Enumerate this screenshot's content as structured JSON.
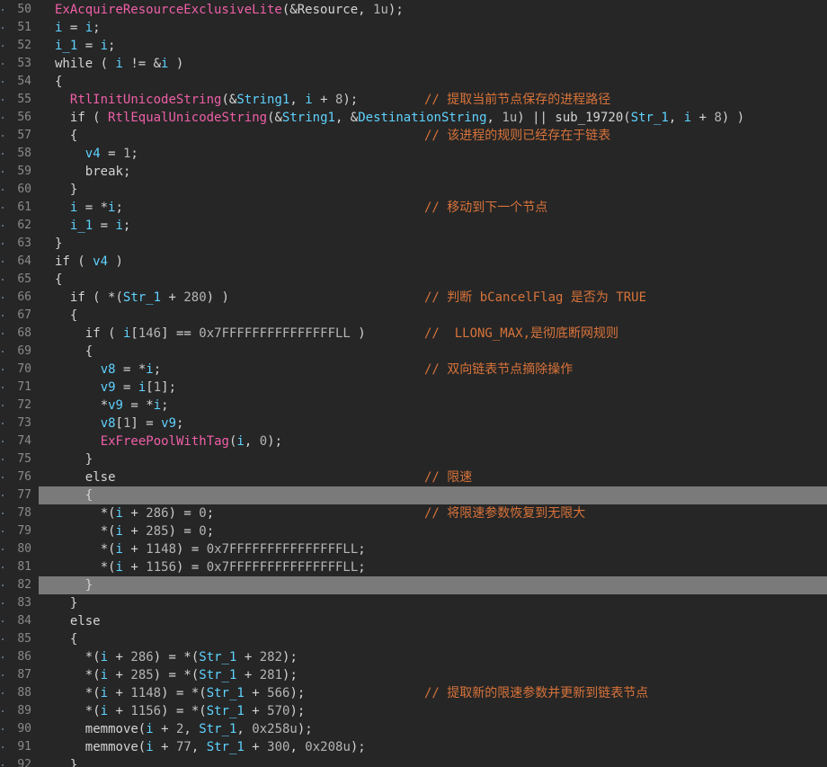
{
  "colors": {
    "background": "#262626",
    "gutter_text": "#8a8a8a",
    "current_line_highlight": "#7a7a7a",
    "plain": "#d4d4d4",
    "function": "#ef5fa7",
    "variable": "#5fd2ff",
    "number": "#b5b5b5",
    "comment": "#d8733a"
  },
  "highlighted_lines": [
    77,
    82
  ],
  "lines": [
    {
      "n": 50,
      "indent": 0,
      "tokens": [
        [
          "fn",
          "ExAcquireResourceExclusiveLite"
        ],
        [
          "txt",
          "(&Resource, "
        ],
        [
          "num",
          "1u"
        ],
        [
          "txt",
          ");"
        ]
      ]
    },
    {
      "n": 51,
      "indent": 0,
      "tokens": [
        [
          "var",
          "i"
        ],
        [
          "txt",
          " = "
        ],
        [
          "var",
          "i"
        ],
        [
          "txt",
          ";"
        ]
      ]
    },
    {
      "n": 52,
      "indent": 0,
      "tokens": [
        [
          "var",
          "i_1"
        ],
        [
          "txt",
          " = "
        ],
        [
          "var",
          "i"
        ],
        [
          "txt",
          ";"
        ]
      ]
    },
    {
      "n": 53,
      "indent": 0,
      "tokens": [
        [
          "kw",
          "while"
        ],
        [
          "txt",
          " ( "
        ],
        [
          "var",
          "i"
        ],
        [
          "txt",
          " != &"
        ],
        [
          "var",
          "i"
        ],
        [
          "txt",
          " )"
        ]
      ]
    },
    {
      "n": 54,
      "indent": 0,
      "tokens": [
        [
          "txt",
          "{"
        ]
      ]
    },
    {
      "n": 55,
      "indent": 1,
      "tokens": [
        [
          "fn",
          "RtlInitUnicodeString"
        ],
        [
          "txt",
          "(&"
        ],
        [
          "var",
          "String1"
        ],
        [
          "txt",
          ", "
        ],
        [
          "var",
          "i"
        ],
        [
          "txt",
          " + "
        ],
        [
          "num",
          "8"
        ],
        [
          "txt",
          ");"
        ]
      ],
      "comment": "// 提取当前节点保存的进程路径"
    },
    {
      "n": 56,
      "indent": 1,
      "tokens": [
        [
          "kw",
          "if"
        ],
        [
          "txt",
          " ( "
        ],
        [
          "fn",
          "RtlEqualUnicodeString"
        ],
        [
          "txt",
          "(&"
        ],
        [
          "var",
          "String1"
        ],
        [
          "txt",
          ", &"
        ],
        [
          "var",
          "DestinationString"
        ],
        [
          "txt",
          ", "
        ],
        [
          "num",
          "1u"
        ],
        [
          "txt",
          ") || "
        ],
        [
          "txt",
          "sub_19720"
        ],
        [
          "txt",
          "("
        ],
        [
          "var",
          "Str_1"
        ],
        [
          "txt",
          ", "
        ],
        [
          "var",
          "i"
        ],
        [
          "txt",
          " + "
        ],
        [
          "num",
          "8"
        ],
        [
          "txt",
          ") )"
        ]
      ]
    },
    {
      "n": 57,
      "indent": 1,
      "tokens": [
        [
          "txt",
          "{"
        ]
      ],
      "comment": "// 该进程的规则已经存在于链表"
    },
    {
      "n": 58,
      "indent": 2,
      "tokens": [
        [
          "var",
          "v4"
        ],
        [
          "txt",
          " = "
        ],
        [
          "num",
          "1"
        ],
        [
          "txt",
          ";"
        ]
      ]
    },
    {
      "n": 59,
      "indent": 2,
      "tokens": [
        [
          "kw",
          "break"
        ],
        [
          "txt",
          ";"
        ]
      ]
    },
    {
      "n": 60,
      "indent": 1,
      "tokens": [
        [
          "txt",
          "}"
        ]
      ]
    },
    {
      "n": 61,
      "indent": 1,
      "tokens": [
        [
          "var",
          "i"
        ],
        [
          "txt",
          " = *"
        ],
        [
          "var",
          "i"
        ],
        [
          "txt",
          ";"
        ]
      ],
      "comment": "// 移动到下一个节点"
    },
    {
      "n": 62,
      "indent": 1,
      "tokens": [
        [
          "var",
          "i_1"
        ],
        [
          "txt",
          " = "
        ],
        [
          "var",
          "i"
        ],
        [
          "txt",
          ";"
        ]
      ]
    },
    {
      "n": 63,
      "indent": 0,
      "tokens": [
        [
          "txt",
          "}"
        ]
      ]
    },
    {
      "n": 64,
      "indent": 0,
      "tokens": [
        [
          "kw",
          "if"
        ],
        [
          "txt",
          " ( "
        ],
        [
          "var",
          "v4"
        ],
        [
          "txt",
          " )"
        ]
      ]
    },
    {
      "n": 65,
      "indent": 0,
      "tokens": [
        [
          "txt",
          "{"
        ]
      ]
    },
    {
      "n": 66,
      "indent": 1,
      "tokens": [
        [
          "kw",
          "if"
        ],
        [
          "txt",
          " ( *("
        ],
        [
          "var",
          "Str_1"
        ],
        [
          "txt",
          " + "
        ],
        [
          "num",
          "280"
        ],
        [
          "txt",
          ") )"
        ]
      ],
      "comment": "// 判断 bCancelFlag 是否为 TRUE"
    },
    {
      "n": 67,
      "indent": 1,
      "tokens": [
        [
          "txt",
          "{"
        ]
      ]
    },
    {
      "n": 68,
      "indent": 2,
      "tokens": [
        [
          "kw",
          "if"
        ],
        [
          "txt",
          " ( "
        ],
        [
          "var",
          "i"
        ],
        [
          "txt",
          "["
        ],
        [
          "num",
          "146"
        ],
        [
          "txt",
          "] == "
        ],
        [
          "num",
          "0x7FFFFFFFFFFFFFFFLL"
        ],
        [
          "txt",
          " )"
        ]
      ],
      "comment": "//  LLONG_MAX,是彻底断网规则"
    },
    {
      "n": 69,
      "indent": 2,
      "tokens": [
        [
          "txt",
          "{"
        ]
      ]
    },
    {
      "n": 70,
      "indent": 3,
      "tokens": [
        [
          "var",
          "v8"
        ],
        [
          "txt",
          " = *"
        ],
        [
          "var",
          "i"
        ],
        [
          "txt",
          ";"
        ]
      ],
      "comment": "// 双向链表节点摘除操作"
    },
    {
      "n": 71,
      "indent": 3,
      "tokens": [
        [
          "var",
          "v9"
        ],
        [
          "txt",
          " = "
        ],
        [
          "var",
          "i"
        ],
        [
          "txt",
          "["
        ],
        [
          "num",
          "1"
        ],
        [
          "txt",
          "];"
        ]
      ]
    },
    {
      "n": 72,
      "indent": 3,
      "tokens": [
        [
          "txt",
          "*"
        ],
        [
          "var",
          "v9"
        ],
        [
          "txt",
          " = *"
        ],
        [
          "var",
          "i"
        ],
        [
          "txt",
          ";"
        ]
      ]
    },
    {
      "n": 73,
      "indent": 3,
      "tokens": [
        [
          "var",
          "v8"
        ],
        [
          "txt",
          "["
        ],
        [
          "num",
          "1"
        ],
        [
          "txt",
          "] = "
        ],
        [
          "var",
          "v9"
        ],
        [
          "txt",
          ";"
        ]
      ]
    },
    {
      "n": 74,
      "indent": 3,
      "tokens": [
        [
          "fn",
          "ExFreePoolWithTag"
        ],
        [
          "txt",
          "("
        ],
        [
          "var",
          "i"
        ],
        [
          "txt",
          ", "
        ],
        [
          "num",
          "0"
        ],
        [
          "txt",
          ");"
        ]
      ]
    },
    {
      "n": 75,
      "indent": 2,
      "tokens": [
        [
          "txt",
          "}"
        ]
      ]
    },
    {
      "n": 76,
      "indent": 2,
      "tokens": [
        [
          "kw",
          "else"
        ]
      ],
      "comment": "// 限速"
    },
    {
      "n": 77,
      "indent": 2,
      "tokens": [
        [
          "txt",
          "{"
        ]
      ]
    },
    {
      "n": 78,
      "indent": 3,
      "tokens": [
        [
          "txt",
          "*("
        ],
        [
          "var",
          "i"
        ],
        [
          "txt",
          " + "
        ],
        [
          "num",
          "286"
        ],
        [
          "txt",
          ") = "
        ],
        [
          "num",
          "0"
        ],
        [
          "txt",
          ";"
        ]
      ],
      "comment": "// 将限速参数恢复到无限大"
    },
    {
      "n": 79,
      "indent": 3,
      "tokens": [
        [
          "txt",
          "*("
        ],
        [
          "var",
          "i"
        ],
        [
          "txt",
          " + "
        ],
        [
          "num",
          "285"
        ],
        [
          "txt",
          ") = "
        ],
        [
          "num",
          "0"
        ],
        [
          "txt",
          ";"
        ]
      ]
    },
    {
      "n": 80,
      "indent": 3,
      "tokens": [
        [
          "txt",
          "*("
        ],
        [
          "var",
          "i"
        ],
        [
          "txt",
          " + "
        ],
        [
          "num",
          "1148"
        ],
        [
          "txt",
          ") = "
        ],
        [
          "num",
          "0x7FFFFFFFFFFFFFFFLL"
        ],
        [
          "txt",
          ";"
        ]
      ]
    },
    {
      "n": 81,
      "indent": 3,
      "tokens": [
        [
          "txt",
          "*("
        ],
        [
          "var",
          "i"
        ],
        [
          "txt",
          " + "
        ],
        [
          "num",
          "1156"
        ],
        [
          "txt",
          ") = "
        ],
        [
          "num",
          "0x7FFFFFFFFFFFFFFFLL"
        ],
        [
          "txt",
          ";"
        ]
      ]
    },
    {
      "n": 82,
      "indent": 2,
      "tokens": [
        [
          "txt",
          "}"
        ]
      ]
    },
    {
      "n": 83,
      "indent": 1,
      "tokens": [
        [
          "txt",
          "}"
        ]
      ]
    },
    {
      "n": 84,
      "indent": 1,
      "tokens": [
        [
          "kw",
          "else"
        ]
      ]
    },
    {
      "n": 85,
      "indent": 1,
      "tokens": [
        [
          "txt",
          "{"
        ]
      ]
    },
    {
      "n": 86,
      "indent": 2,
      "tokens": [
        [
          "txt",
          "*("
        ],
        [
          "var",
          "i"
        ],
        [
          "txt",
          " + "
        ],
        [
          "num",
          "286"
        ],
        [
          "txt",
          ") = *("
        ],
        [
          "var",
          "Str_1"
        ],
        [
          "txt",
          " + "
        ],
        [
          "num",
          "282"
        ],
        [
          "txt",
          ");"
        ]
      ]
    },
    {
      "n": 87,
      "indent": 2,
      "tokens": [
        [
          "txt",
          "*("
        ],
        [
          "var",
          "i"
        ],
        [
          "txt",
          " + "
        ],
        [
          "num",
          "285"
        ],
        [
          "txt",
          ") = *("
        ],
        [
          "var",
          "Str_1"
        ],
        [
          "txt",
          " + "
        ],
        [
          "num",
          "281"
        ],
        [
          "txt",
          ");"
        ]
      ]
    },
    {
      "n": 88,
      "indent": 2,
      "tokens": [
        [
          "txt",
          "*("
        ],
        [
          "var",
          "i"
        ],
        [
          "txt",
          " + "
        ],
        [
          "num",
          "1148"
        ],
        [
          "txt",
          ") = *("
        ],
        [
          "var",
          "Str_1"
        ],
        [
          "txt",
          " + "
        ],
        [
          "num",
          "566"
        ],
        [
          "txt",
          ");"
        ]
      ],
      "comment": "// 提取新的限速参数并更新到链表节点"
    },
    {
      "n": 89,
      "indent": 2,
      "tokens": [
        [
          "txt",
          "*("
        ],
        [
          "var",
          "i"
        ],
        [
          "txt",
          " + "
        ],
        [
          "num",
          "1156"
        ],
        [
          "txt",
          ") = *("
        ],
        [
          "var",
          "Str_1"
        ],
        [
          "txt",
          " + "
        ],
        [
          "num",
          "570"
        ],
        [
          "txt",
          ");"
        ]
      ]
    },
    {
      "n": 90,
      "indent": 2,
      "tokens": [
        [
          "txt",
          "memmove("
        ],
        [
          "var",
          "i"
        ],
        [
          "txt",
          " + "
        ],
        [
          "num",
          "2"
        ],
        [
          "txt",
          ", "
        ],
        [
          "var",
          "Str_1"
        ],
        [
          "txt",
          ", "
        ],
        [
          "num",
          "0x258u"
        ],
        [
          "txt",
          ");"
        ]
      ]
    },
    {
      "n": 91,
      "indent": 2,
      "tokens": [
        [
          "txt",
          "memmove("
        ],
        [
          "var",
          "i"
        ],
        [
          "txt",
          " + "
        ],
        [
          "num",
          "77"
        ],
        [
          "txt",
          ", "
        ],
        [
          "var",
          "Str_1"
        ],
        [
          "txt",
          " + "
        ],
        [
          "num",
          "300"
        ],
        [
          "txt",
          ", "
        ],
        [
          "num",
          "0x208u"
        ],
        [
          "txt",
          ");"
        ]
      ]
    },
    {
      "n": 92,
      "indent": 1,
      "tokens": [
        [
          "txt",
          "}"
        ]
      ]
    }
  ]
}
